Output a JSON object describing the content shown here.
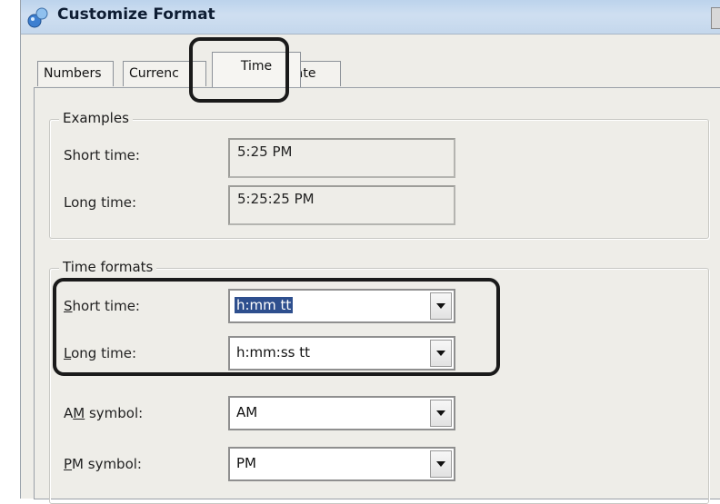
{
  "window": {
    "title": "Customize Format"
  },
  "tabs": [
    {
      "label": "Numbers"
    },
    {
      "label": "Currenc"
    },
    {
      "label": "Time"
    },
    {
      "label": "Date"
    }
  ],
  "examples": {
    "legend": "Examples",
    "short_label": "Short time:",
    "short_value": "5:25 PM",
    "long_label": "Long time:",
    "long_value": "5:25:25 PM"
  },
  "time_formats": {
    "legend": "Time formats",
    "short": {
      "label_u": "S",
      "label_rest": "hort time:",
      "value": "h:mm tt"
    },
    "long": {
      "label_u": "L",
      "label_rest": "ong time:",
      "value": "h:mm:ss tt"
    },
    "am": {
      "label_pre": "A",
      "label_u": "M",
      "label_rest": " symbol:",
      "value": "AM"
    },
    "pm": {
      "label_u": "P",
      "label_rest": "M symbol:",
      "value": "PM"
    }
  },
  "colors": {
    "selection": "#2e4f8e",
    "highlight_outline": "#1a1a1a"
  },
  "icons": [
    "app-icon",
    "dropdown-arrow-icon"
  ]
}
